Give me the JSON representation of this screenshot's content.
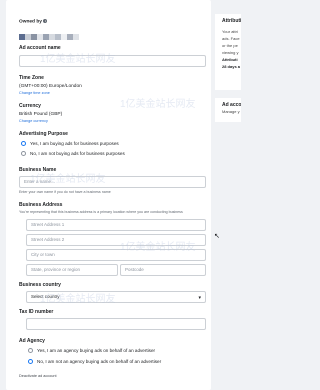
{
  "owned_by": {
    "label": "Owned by",
    "info_icon": "info-icon"
  },
  "ad_account_name": {
    "label": "Ad account name",
    "value": ""
  },
  "time_zone": {
    "label": "Time Zone",
    "value": "(GMT+00:00) Europe/London",
    "link": "Change time zone"
  },
  "currency": {
    "label": "Currency",
    "value": "British Pound (GBP)",
    "link": "Change currency"
  },
  "advertising_purpose": {
    "label": "Advertising Purpose",
    "options": [
      "Yes, I am buying ads for business purposes",
      "No, I am not buying ads for business purposes"
    ],
    "selected_index": 0
  },
  "business_name": {
    "label": "Business Name",
    "placeholder": "Enter a name...",
    "hint": "Enter your own name if you do not have a business name"
  },
  "business_address": {
    "label": "Business Address",
    "hint": "You're representing that this business address is a primary location where you are conducting business",
    "street1": "Street Address 1",
    "street2": "Street Address 2",
    "city": "City or town",
    "state": "State, province or region",
    "postcode": "Postcode"
  },
  "business_country": {
    "label": "Business country",
    "placeholder": "Select country"
  },
  "tax_id": {
    "label": "Tax ID number",
    "value": ""
  },
  "ad_agency": {
    "label": "Ad Agency",
    "options": [
      "Yes, I am an agency buying ads on behalf of an advertiser",
      "No, I am not an agency buying ads on behalf of an advertiser"
    ],
    "selected_index": 1
  },
  "deactivate_link": "Deactivate ad account",
  "side_panel": {
    "attribution_title": "Attributi",
    "attribution_lines": [
      "Your attri",
      "ads. Face",
      "or the pe",
      "viewing y"
    ],
    "attribution_setting_label": "Attributi",
    "attribution_setting_value": "28 days a",
    "ad_account_title": "Ad accou",
    "ad_account_link": "Manage y"
  },
  "colors": {
    "accent": "#1877f2",
    "link": "#216fdb",
    "border": "#ccd0d5",
    "page_bg": "#f0f2f5"
  }
}
